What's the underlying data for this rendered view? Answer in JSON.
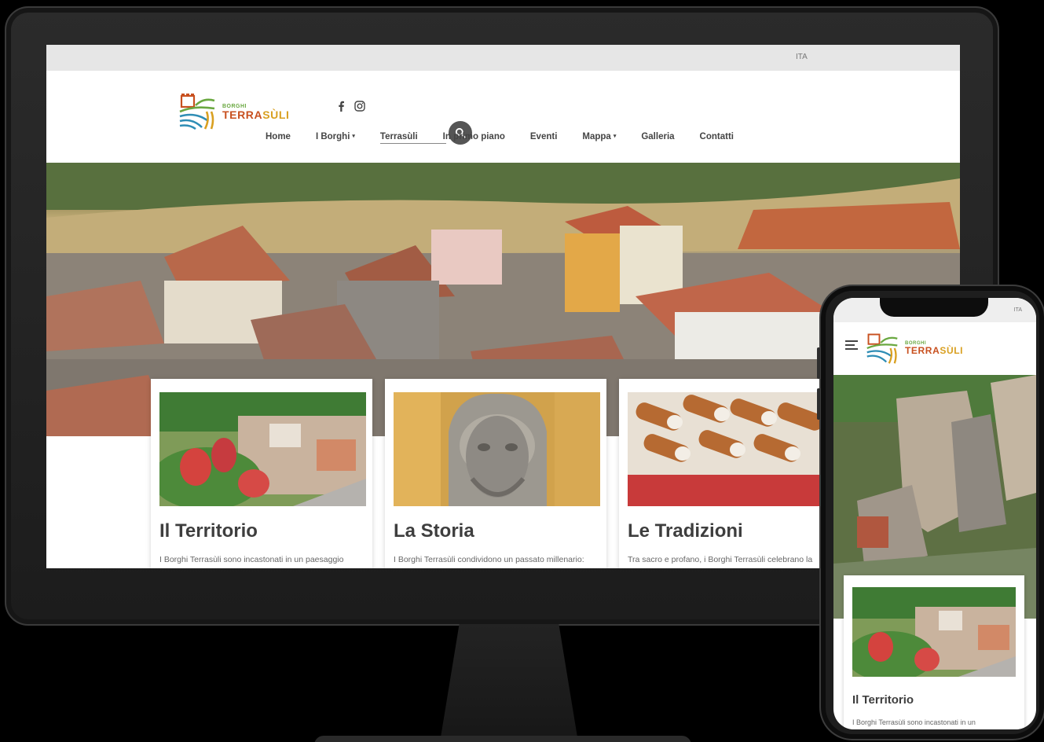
{
  "desktop": {
    "topbar": {
      "language": "ITA"
    },
    "brand": {
      "small": "BORGHI",
      "big_a": "TERRA",
      "big_b": "SÙLI"
    },
    "social": {
      "facebook_icon": "facebook-icon",
      "instagram_icon": "instagram-icon"
    },
    "search": {
      "value": "",
      "icon": "search-icon"
    },
    "nav": {
      "items": [
        {
          "label": "Home",
          "dropdown": false
        },
        {
          "label": "I Borghi",
          "dropdown": true
        },
        {
          "label": "Terrasùli",
          "dropdown": false
        },
        {
          "label": "In primo piano",
          "dropdown": false
        },
        {
          "label": "Eventi",
          "dropdown": false
        },
        {
          "label": "Mappa",
          "dropdown": true
        },
        {
          "label": "Galleria",
          "dropdown": false
        },
        {
          "label": "Contatti",
          "dropdown": false
        }
      ],
      "caret": "▾"
    },
    "cards": [
      {
        "title": "Il Territorio",
        "text": "I Borghi Terrasùli sono incastonati in un paesaggio"
      },
      {
        "title": "La Storia",
        "text": "I Borghi Terrasùli condividono un passato millenario:"
      },
      {
        "title": "Le Tradizioni",
        "text": "Tra sacro e profano, i Borghi Terrasùli celebrano la"
      }
    ]
  },
  "mobile": {
    "topbar": {
      "language": "ITA"
    },
    "brand": {
      "small": "BORGHI",
      "big_a": "TERRA",
      "big_b": "SÙLI"
    },
    "menu_icon": "hamburger-icon",
    "card": {
      "title": "Il Territorio",
      "text": "I Borghi Terrasùli sono incastonati in un"
    }
  },
  "colors": {
    "brand_orange": "#c8501f",
    "brand_gold": "#d9a021",
    "brand_green": "#6aa840",
    "topbar_bg": "#e6e6e6",
    "search_button": "#555555"
  }
}
